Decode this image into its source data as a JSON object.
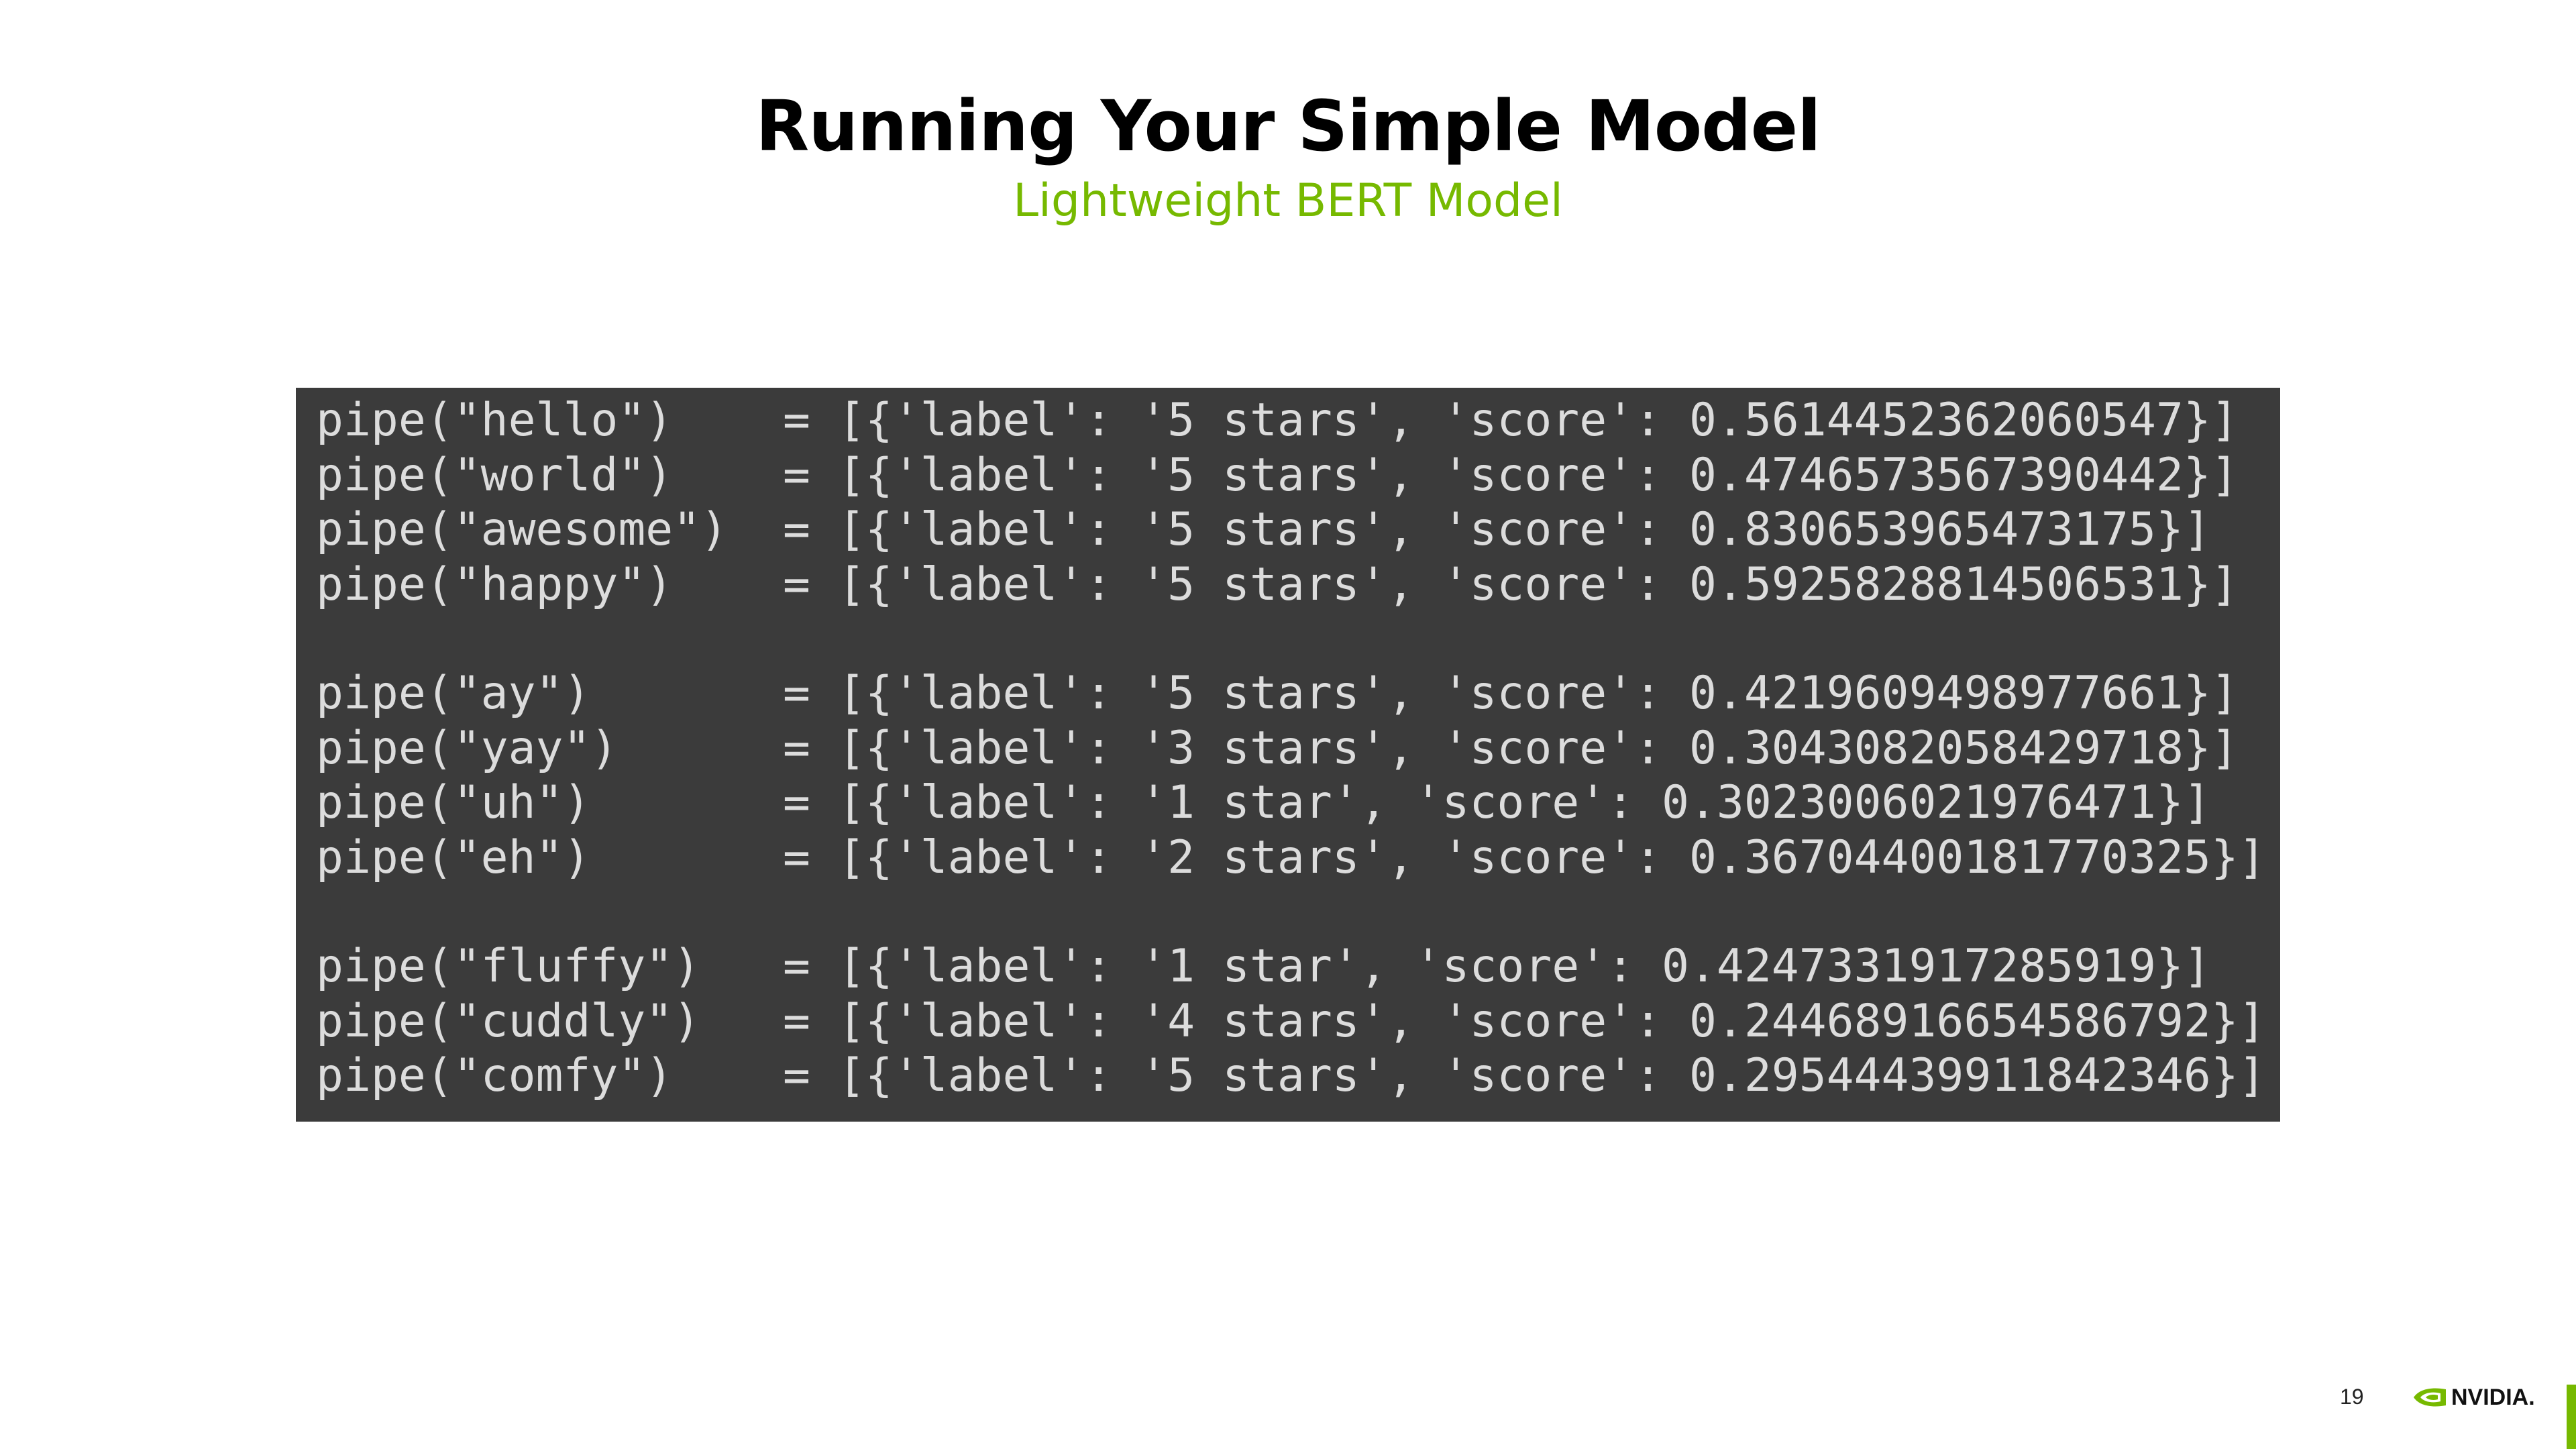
{
  "slide": {
    "title": "Running Your Simple Model",
    "subtitle": "Lightweight BERT Model",
    "page_number": "19",
    "logo_text": "NVIDIA.",
    "accent_color": "#76b900"
  },
  "code": {
    "groups": [
      [
        "pipe(\"hello\")    = [{'label': '5 stars', 'score': 0.5614452362060547}]",
        "pipe(\"world\")    = [{'label': '5 stars', 'score': 0.4746573567390442}]",
        "pipe(\"awesome\")  = [{'label': '5 stars', 'score': 0.830653965473175}]",
        "pipe(\"happy\")    = [{'label': '5 stars', 'score': 0.5925828814506531}]"
      ],
      [
        "pipe(\"ay\")       = [{'label': '5 stars', 'score': 0.4219609498977661}]",
        "pipe(\"yay\")      = [{'label': '3 stars', 'score': 0.3043082058429718}]",
        "pipe(\"uh\")       = [{'label': '1 star', 'score': 0.3023006021976471}]",
        "pipe(\"eh\")       = [{'label': '2 stars', 'score': 0.36704400181770325}]"
      ],
      [
        "pipe(\"fluffy\")   = [{'label': '1 star', 'score': 0.4247331917285919}]",
        "pipe(\"cuddly\")   = [{'label': '4 stars', 'score': 0.24468916654586792}]",
        "pipe(\"comfy\")    = [{'label': '5 stars', 'score': 0.29544439911842346}]"
      ]
    ]
  },
  "icons": {
    "logo": "nvidia-eye-logo-icon"
  }
}
